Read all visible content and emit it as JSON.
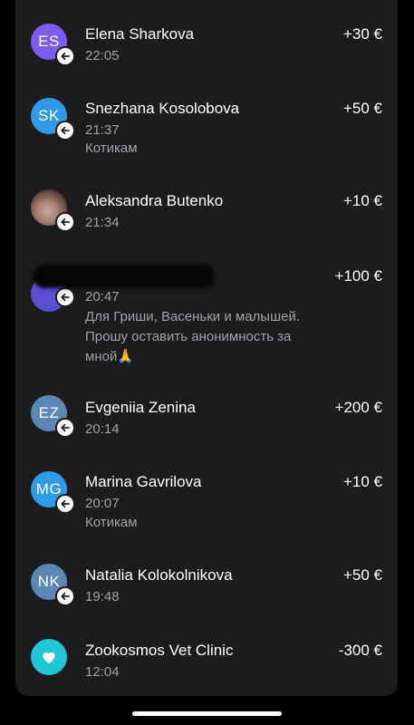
{
  "transactions": [
    {
      "initials": "ES",
      "name": "Elena Sharkova",
      "time": "22:05",
      "note": "",
      "amount": "+30 €",
      "color": "#7b5cf0"
    },
    {
      "initials": "SK",
      "name": "Snezhana Kosolobova",
      "time": "21:37",
      "note": "Котикам",
      "amount": "+50 €",
      "color": "#2f9be8"
    },
    {
      "initials": "",
      "name": "Aleksandra Butenko",
      "time": "21:34",
      "note": "",
      "amount": "+10 €",
      "color": "#a87f73"
    },
    {
      "initials": "",
      "name": "",
      "time": "20:47",
      "note": "Для Гриши, Васеньки и малышей. Прошу оставить анонимность за мной🙏",
      "amount": "+100 €",
      "color": "#5a4fd0"
    },
    {
      "initials": "EZ",
      "name": "Evgeniia Zenina",
      "time": "20:14",
      "note": "",
      "amount": "+200 €",
      "color": "#5b86b5"
    },
    {
      "initials": "MG",
      "name": "Marina Gavrilova",
      "time": "20:07",
      "note": "Котикам",
      "amount": "+10 €",
      "color": "#2f9be8"
    },
    {
      "initials": "NK",
      "name": "Natalia Kolokolnikova",
      "time": "19:48",
      "note": "",
      "amount": "+50 €",
      "color": "#5b86b5"
    },
    {
      "initials": "",
      "name": "Zookosmos Vet Clinic",
      "time": "12:04",
      "note": "",
      "amount": "-300 €",
      "color": "#1ec6d6"
    }
  ]
}
